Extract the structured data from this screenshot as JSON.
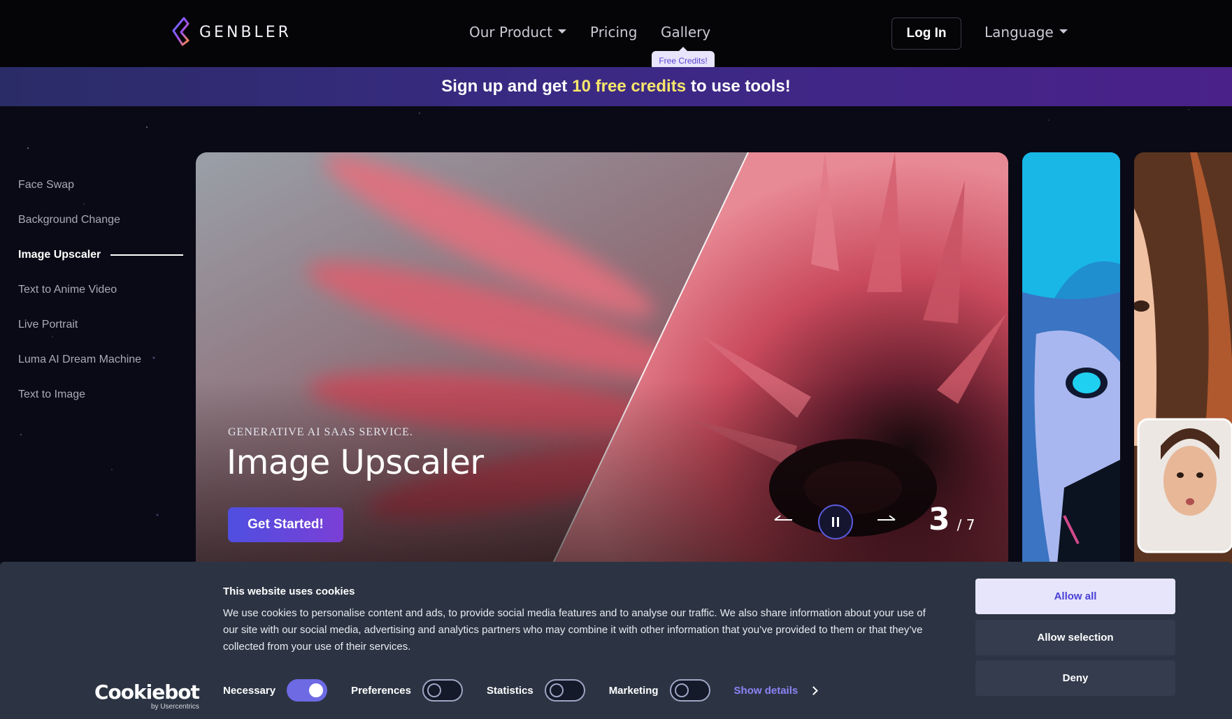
{
  "brand": {
    "name": "GENBLER"
  },
  "nav": {
    "items": [
      {
        "label": "Our Product",
        "has_dropdown": true
      },
      {
        "label": "Pricing"
      },
      {
        "label": "Gallery"
      }
    ],
    "gallery_badge": "Free Credits!",
    "login_label": "Log In",
    "language_label": "Language"
  },
  "promo": {
    "before": "Sign up and get",
    "highlight": "10 free credits",
    "after": "to use tools!",
    "highlight_color": "#f5e66b"
  },
  "sidebar": {
    "items": [
      {
        "label": "Face Swap"
      },
      {
        "label": "Background Change"
      },
      {
        "label": "Image Upscaler",
        "active": true
      },
      {
        "label": "Text to Anime Video"
      },
      {
        "label": "Live Portrait"
      },
      {
        "label": "Luma AI Dream Machine"
      },
      {
        "label": "Text to Image"
      }
    ]
  },
  "hero": {
    "eyebrow": "Generative AI SaaS Service.",
    "title": "Image Upscaler",
    "cta_label": "Get Started!",
    "prev_icon": "arrow-left-icon",
    "next_icon": "arrow-right-icon",
    "pause_icon": "pause-icon",
    "current": "3",
    "total": "/ 7"
  },
  "cookie": {
    "title": "This website uses cookies",
    "text": "We use cookies to personalise content and ads, to provide social media features and to analyse our traffic. We also share information about your use of our site with our social media, advertising and analytics partners who may combine it with other information that you’ve provided to them or that they’ve collected from your use of their services.",
    "logo_main": "Cookiebot",
    "logo_sub": "by Usercentrics",
    "consents": [
      {
        "label": "Necessary",
        "on": true
      },
      {
        "label": "Preferences",
        "on": false
      },
      {
        "label": "Statistics",
        "on": false
      },
      {
        "label": "Marketing",
        "on": false
      }
    ],
    "show_details": "Show details",
    "allow_all": "Allow all",
    "allow_selection": "Allow selection",
    "deny": "Deny"
  },
  "colors": {
    "accent": "#6d6ae4",
    "cta_start": "#4f4fe0",
    "cta_end": "#7b3fd6",
    "cookie_bg": "#2c3443"
  }
}
